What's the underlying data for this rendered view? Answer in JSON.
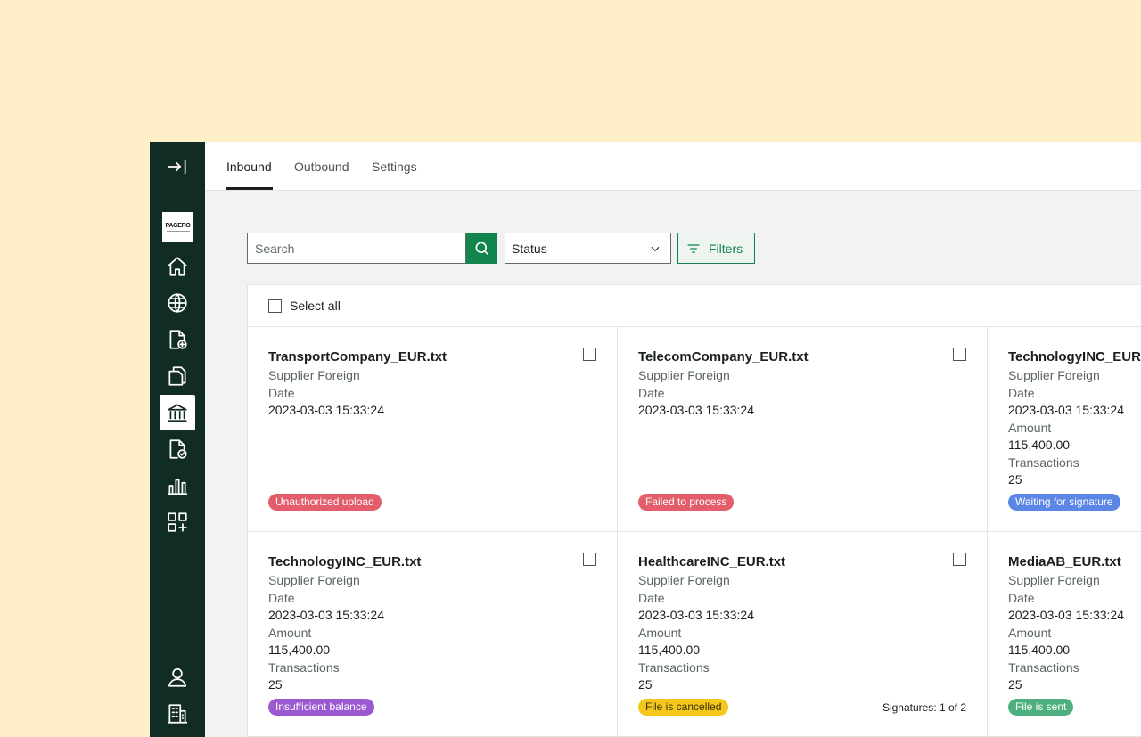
{
  "tabs": [
    {
      "label": "Inbound",
      "active": true
    },
    {
      "label": "Outbound",
      "active": false
    },
    {
      "label": "Settings",
      "active": false
    }
  ],
  "sidebar": {
    "logo_text": "PAGERO",
    "icons": [
      "collapse-icon",
      "home-icon",
      "globe-icon",
      "new-document-icon",
      "documents-icon",
      "bank-icon",
      "approved-document-icon",
      "chart-icon",
      "add-app-icon",
      "user-icon",
      "building-icon"
    ],
    "active_icon": "bank-icon"
  },
  "search": {
    "placeholder": "Search",
    "value": ""
  },
  "status_select": {
    "selected": "Status"
  },
  "filters": {
    "label": "Filters"
  },
  "select_all": {
    "label": "Select all"
  },
  "labels": {
    "date": "Date",
    "amount": "Amount",
    "transactions": "Transactions"
  },
  "cards": [
    {
      "title": "TransportCompany_EUR.txt",
      "supplier": "Supplier Foreign",
      "date": "2023-03-03 15:33:24",
      "status": "Unauthorized upload",
      "status_color": "#e35d6a"
    },
    {
      "title": "TelecomCompany_EUR.txt",
      "supplier": "Supplier Foreign",
      "date": "2023-03-03 15:33:24",
      "status": "Failed to process",
      "status_color": "#e35d6a"
    },
    {
      "title": "TechnologyINC_EUR.txt",
      "supplier": "Supplier Foreign",
      "date": "2023-03-03 15:33:24",
      "amount": "115,400.00",
      "transactions": "25",
      "status": "Waiting for signature",
      "status_color": "#5b86e5"
    },
    {
      "title": "TechnologyINC_EUR.txt",
      "supplier": "Supplier Foreign",
      "date": "2023-03-03 15:33:24",
      "amount": "115,400.00",
      "transactions": "25",
      "status": "Insufficient balance",
      "status_color": "#9b59d0"
    },
    {
      "title": "HealthcareINC_EUR.txt",
      "supplier": "Supplier Foreign",
      "date": "2023-03-03 15:33:24",
      "amount": "115,400.00",
      "transactions": "25",
      "status": "File is cancelled",
      "status_color": "#f5c61b",
      "signatures": "Signatures: 1 of 2"
    },
    {
      "title": "MediaAB_EUR.txt",
      "supplier": "Supplier Foreign",
      "date": "2023-03-03 15:33:24",
      "amount": "115,400.00",
      "transactions": "25",
      "status": "File is sent",
      "status_color": "#4caf7d"
    }
  ]
}
